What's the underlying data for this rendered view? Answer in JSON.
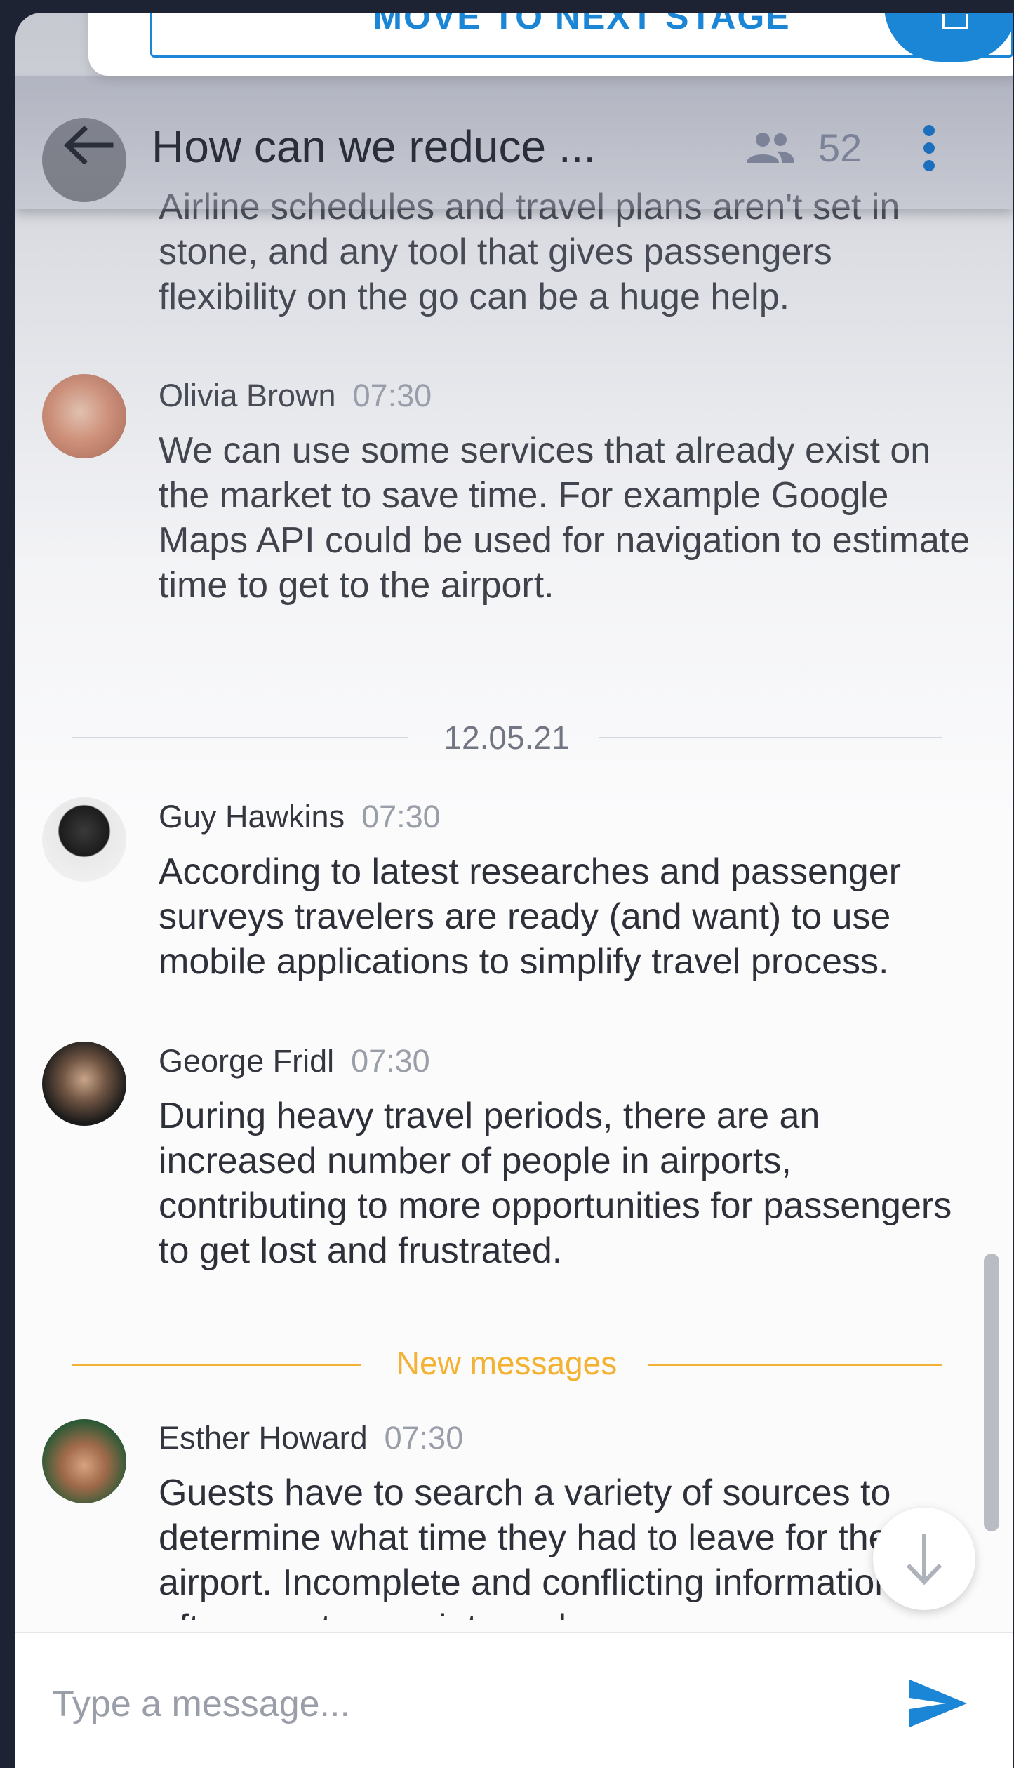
{
  "stage": {
    "button_label": "MOVE TO NEXT STAGE"
  },
  "header": {
    "title": "How can we reduce ...",
    "member_count": "52"
  },
  "messages": [
    {
      "text": "Airline schedules and travel plans aren't set in stone, and any tool that gives passengers flexibility on the go can be a huge help."
    },
    {
      "author": "Olivia Brown",
      "time": "07:30",
      "text": "We can use some services that already exist on the market to save time. For example Google Maps API could be used for navigation to estimate time to get to the airport."
    },
    {
      "author": "Guy Hawkins",
      "time": "07:30",
      "text": "According to latest researches and passenger surveys travelers are ready (and want) to use mobile applications to simplify travel process."
    },
    {
      "author": "George Fridl",
      "time": "07:30",
      "text": "During heavy travel periods, there are an increased number of people in airports, contributing to more opportunities for passengers to get lost and frustrated."
    },
    {
      "author": "Esther Howard",
      "time": "07:30",
      "text": "Guests have to search a variety of sources to determine what time they had to leave for the airport. Incomplete and conflicting information often creates anxiety and a"
    }
  ],
  "dividers": {
    "date": "12.05.21",
    "new_messages": "New messages"
  },
  "composer": {
    "placeholder": "Type a message..."
  },
  "colors": {
    "accent": "#1c86d6",
    "new_messages": "#f3b233"
  },
  "icons": [
    "arrow-back-icon",
    "people-icon",
    "more-vert-icon",
    "arrow-down-icon",
    "send-icon"
  ]
}
